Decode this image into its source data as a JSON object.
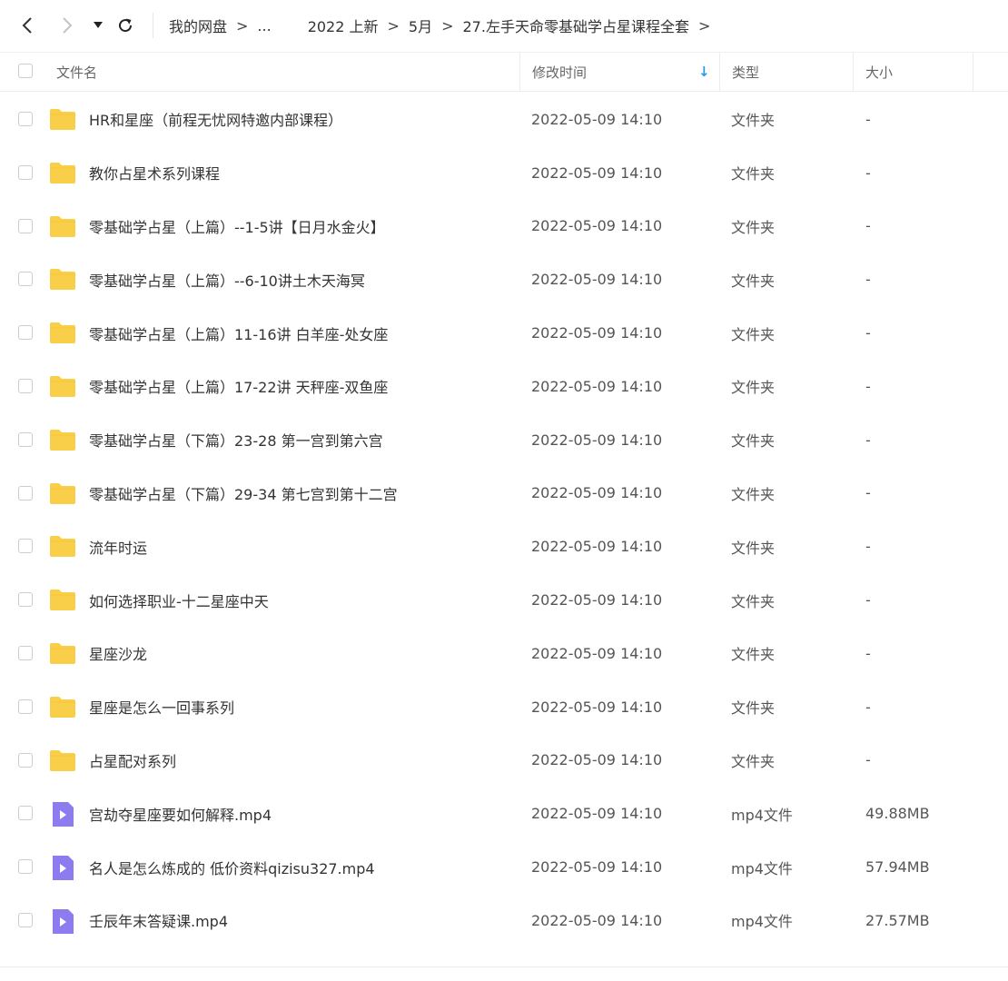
{
  "breadcrumbs": [
    "我的网盘",
    "...",
    "2022 上新",
    "5月",
    "27.左手天命零基础学占星课程全套"
  ],
  "breadcrumb_separator": ">",
  "icons": {
    "back": "chevron-left-icon",
    "forward": "chevron-right-icon",
    "history": "caret-down-icon",
    "refresh": "refresh-icon"
  },
  "header": {
    "name": "文件名",
    "modified": "修改时间",
    "type": "类型",
    "size": "大小",
    "sort_indicator": "↓"
  },
  "colors": {
    "folder": "#f9cf49",
    "video": "#8c7cf0",
    "sort_arrow": "#2f98e6"
  },
  "files": [
    {
      "name": "HR和星座（前程无忧网特邀内部课程）",
      "modified": "2022-05-09 14:10",
      "type": "文件夹",
      "size": "-",
      "kind": "folder"
    },
    {
      "name": "教你占星术系列课程",
      "modified": "2022-05-09 14:10",
      "type": "文件夹",
      "size": "-",
      "kind": "folder"
    },
    {
      "name": "零基础学占星（上篇）--1-5讲【日月水金火】",
      "modified": "2022-05-09 14:10",
      "type": "文件夹",
      "size": "-",
      "kind": "folder"
    },
    {
      "name": "零基础学占星（上篇）--6-10讲土木天海冥",
      "modified": "2022-05-09 14:10",
      "type": "文件夹",
      "size": "-",
      "kind": "folder"
    },
    {
      "name": "零基础学占星（上篇）11-16讲 白羊座-处女座",
      "modified": "2022-05-09 14:10",
      "type": "文件夹",
      "size": "-",
      "kind": "folder"
    },
    {
      "name": "零基础学占星（上篇）17-22讲 天秤座-双鱼座",
      "modified": "2022-05-09 14:10",
      "type": "文件夹",
      "size": "-",
      "kind": "folder"
    },
    {
      "name": "零基础学占星（下篇）23-28 第一宫到第六宫",
      "modified": "2022-05-09 14:10",
      "type": "文件夹",
      "size": "-",
      "kind": "folder"
    },
    {
      "name": "零基础学占星（下篇）29-34 第七宫到第十二宫",
      "modified": "2022-05-09 14:10",
      "type": "文件夹",
      "size": "-",
      "kind": "folder"
    },
    {
      "name": "流年时运",
      "modified": "2022-05-09 14:10",
      "type": "文件夹",
      "size": "-",
      "kind": "folder"
    },
    {
      "name": "如何选择职业-十二星座中天",
      "modified": "2022-05-09 14:10",
      "type": "文件夹",
      "size": "-",
      "kind": "folder"
    },
    {
      "name": "星座沙龙",
      "modified": "2022-05-09 14:10",
      "type": "文件夹",
      "size": "-",
      "kind": "folder"
    },
    {
      "name": "星座是怎么一回事系列",
      "modified": "2022-05-09 14:10",
      "type": "文件夹",
      "size": "-",
      "kind": "folder"
    },
    {
      "name": "占星配对系列",
      "modified": "2022-05-09 14:10",
      "type": "文件夹",
      "size": "-",
      "kind": "folder"
    },
    {
      "name": "宫劫夺星座要如何解释.mp4",
      "modified": "2022-05-09 14:10",
      "type": "mp4文件",
      "size": "49.88MB",
      "kind": "video"
    },
    {
      "name": "名人是怎么炼成的 低价资料qizisu327.mp4",
      "modified": "2022-05-09 14:10",
      "type": "mp4文件",
      "size": "57.94MB",
      "kind": "video"
    },
    {
      "name": "壬辰年末答疑课.mp4",
      "modified": "2022-05-09 14:10",
      "type": "mp4文件",
      "size": "27.57MB",
      "kind": "video"
    }
  ]
}
